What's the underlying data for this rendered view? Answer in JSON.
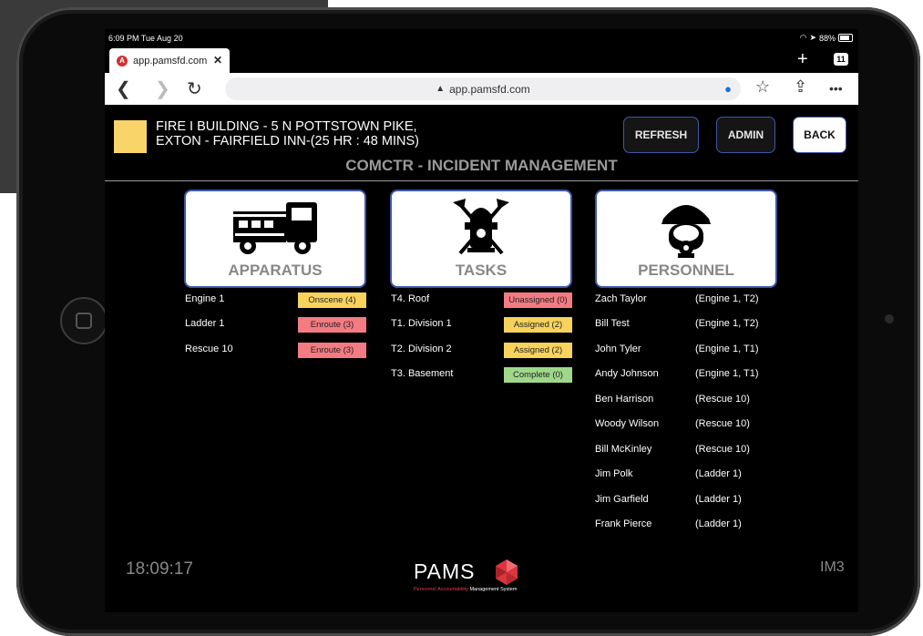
{
  "status": {
    "time": "6:09 PM",
    "date": "Tue Aug 20",
    "battery": "88%"
  },
  "browser": {
    "tab_title": "app.pamsfd.com",
    "tab_count": "11",
    "url": "app.pamsfd.com"
  },
  "incident": {
    "line1": "FIRE I BUILDING - 5 N POTTSTOWN PIKE,",
    "line2": "EXTON - FAIRFIELD INN-(25 HR : 48 MINS)",
    "color": "#f9d469"
  },
  "header": {
    "refresh": "REFRESH",
    "admin": "ADMIN",
    "back": "BACK"
  },
  "section_title": "COMCTR - INCIDENT MANAGEMENT",
  "cards": {
    "apparatus": "APPARATUS",
    "tasks": "TASKS",
    "personnel": "PERSONNEL"
  },
  "apparatus": [
    {
      "name": "Engine 1",
      "status": "Onscene (4)",
      "color": "yellow"
    },
    {
      "name": "Ladder 1",
      "status": "Enroute (3)",
      "color": "red"
    },
    {
      "name": "Rescue 10",
      "status": "Enroute (3)",
      "color": "red"
    }
  ],
  "tasks": [
    {
      "name": "T4. Roof",
      "status": "Unassigned (0)",
      "color": "red"
    },
    {
      "name": "T1. Division 1",
      "status": "Assigned (2)",
      "color": "yellow"
    },
    {
      "name": "T2. Division 2",
      "status": "Assigned (2)",
      "color": "yellow"
    },
    {
      "name": "T3. Basement",
      "status": "Complete (0)",
      "color": "green"
    }
  ],
  "personnel": [
    {
      "name": "Zach Taylor",
      "unit": "(Engine 1, T2)"
    },
    {
      "name": "Bill Test",
      "unit": "(Engine 1, T2)"
    },
    {
      "name": "John Tyler",
      "unit": "(Engine 1, T1)"
    },
    {
      "name": "Andy Johnson",
      "unit": "(Engine 1, T1)"
    },
    {
      "name": "Ben Harrison",
      "unit": "(Rescue 10)"
    },
    {
      "name": "Woody Wilson",
      "unit": "(Rescue 10)"
    },
    {
      "name": "Bill McKinley",
      "unit": "(Rescue 10)"
    },
    {
      "name": "Jim Polk",
      "unit": "(Ladder 1)"
    },
    {
      "name": "Jim Garfield",
      "unit": "(Ladder 1)"
    },
    {
      "name": "Frank Pierce",
      "unit": "(Ladder 1)"
    }
  ],
  "footer": {
    "clock": "18:09:17",
    "brand": "PAMS",
    "tagline_red": "Personnel Accountability",
    "tagline_white": "Management System",
    "code": "IM3"
  },
  "status_colors": {
    "yellow": "#f7d35c",
    "red": "#f47b82",
    "green": "#9fd88a"
  }
}
